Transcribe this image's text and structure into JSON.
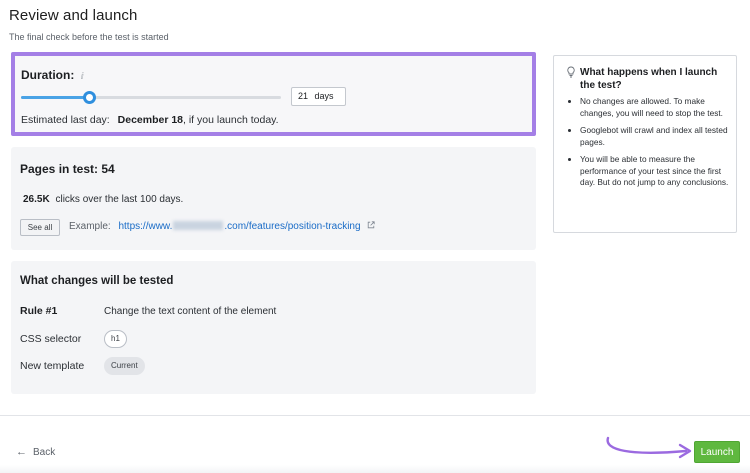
{
  "header": {
    "title": "Review and launch",
    "subtitle": "The final check before the test is started"
  },
  "duration": {
    "title": "Duration:",
    "info_icon": "info-icon",
    "slider_fraction": 0.26,
    "days_value": "21",
    "days_unit": "days",
    "estimate_prefix": "Estimated last day:",
    "estimate_date": "December 18",
    "estimate_suffix": ", if you launch today."
  },
  "pages": {
    "title": "Pages in test: 54",
    "clicks_value": "26.5K",
    "clicks_text": "clicks over the last 100 days.",
    "see_all_label": "See all",
    "example_label": "Example:",
    "url_prefix": "https://www.",
    "url_suffix": ".com/features/position-tracking"
  },
  "changes": {
    "title": "What changes will be tested",
    "rule_label": "Rule #1",
    "rule_value": "Change the text content of the element",
    "css_selector_label": "CSS selector",
    "css_selector_value": "h1",
    "template_label": "New template",
    "template_value": "Current"
  },
  "side_panel": {
    "icon": "lightbulb-icon",
    "title": "What happens when I launch the test?",
    "items": [
      "No changes are allowed. To make changes, you will need to stop the test.",
      "Googlebot will crawl and index all tested pages.",
      "You will be able to measure the performance of your test since the first day. But do not jump to any conclusions."
    ]
  },
  "footer": {
    "back_label": "Back",
    "launch_label": "Launch"
  },
  "colors": {
    "highlight": "#a47fe6",
    "slider": "#2f8fde",
    "link": "#1a6cc7",
    "launch": "#5fb83f"
  }
}
